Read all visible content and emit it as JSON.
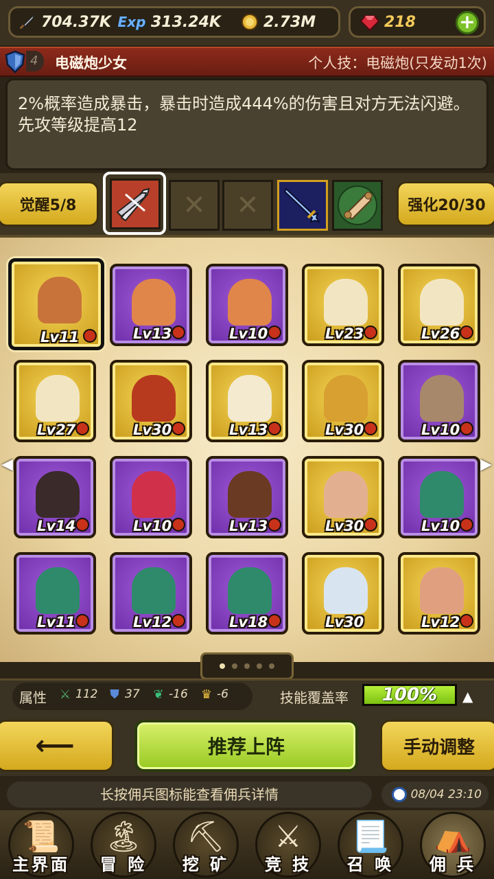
{
  "top": {
    "attack": "704.37K",
    "exp_label": "Exp",
    "exp": "313.24K",
    "gold": "2.73M",
    "gems": "218"
  },
  "skill": {
    "rank": "4",
    "name": "电磁炮少女",
    "personal": "个人技：电磁炮(只发动1次)",
    "description": "2%概率造成暴击，暴击时造成444%的伤害且对方无法闪避。先攻等级提高12"
  },
  "awaken": {
    "label": "觉醒5/8"
  },
  "enhance": {
    "label": "强化20/30"
  },
  "equipment": [
    {
      "icon": "crossed-swords-icon",
      "state": "selected"
    },
    {
      "icon": "empty-slot-icon",
      "state": "empty"
    },
    {
      "icon": "empty-slot-icon",
      "state": "empty"
    },
    {
      "icon": "blue-sword-icon",
      "state": "filled"
    },
    {
      "icon": "scroll-icon",
      "state": "filled"
    }
  ],
  "units": [
    {
      "level": "Lv11",
      "rarity": "gold",
      "color": "#c8733a",
      "selected": true
    },
    {
      "level": "Lv13",
      "rarity": "purple",
      "color": "#e0864a"
    },
    {
      "level": "Lv10",
      "rarity": "purple",
      "color": "#e0864a"
    },
    {
      "level": "Lv23",
      "rarity": "gold",
      "color": "#f2e6c2"
    },
    {
      "level": "Lv26",
      "rarity": "gold",
      "color": "#f2e6c2"
    },
    {
      "level": "Lv27",
      "rarity": "gold",
      "color": "#f2e6c2"
    },
    {
      "level": "Lv30",
      "rarity": "gold",
      "color": "#b83a1e"
    },
    {
      "level": "Lv13",
      "rarity": "gold",
      "color": "#f3ead0"
    },
    {
      "level": "Lv30",
      "rarity": "gold",
      "color": "#d8a030"
    },
    {
      "level": "Lv10",
      "rarity": "purple",
      "color": "#a8886a"
    },
    {
      "level": "Lv14",
      "rarity": "purple",
      "color": "#3a2a2a"
    },
    {
      "level": "Lv10",
      "rarity": "purple",
      "color": "#d0304a"
    },
    {
      "level": "Lv13",
      "rarity": "purple",
      "color": "#6a3a22"
    },
    {
      "level": "Lv30",
      "rarity": "gold",
      "color": "#e2b090"
    },
    {
      "level": "Lv10",
      "rarity": "purple",
      "color": "#2e8a6a"
    },
    {
      "level": "Lv11",
      "rarity": "purple",
      "color": "#2e8a6a"
    },
    {
      "level": "Lv12",
      "rarity": "purple",
      "color": "#2e8a6a"
    },
    {
      "level": "Lv18",
      "rarity": "purple",
      "color": "#2e8a6a"
    },
    {
      "level": "Lv30",
      "rarity": "gold",
      "color": "#d8e4f0",
      "nodot": true
    },
    {
      "level": "Lv12",
      "rarity": "gold",
      "color": "#e0a080"
    }
  ],
  "attributes": {
    "label": "属性",
    "values": [
      "112",
      "37",
      "-16",
      "-6"
    ],
    "coverage_label": "技能覆盖率",
    "coverage": "100%",
    "coverage_fraction": 1.0
  },
  "actions": {
    "back": "⟵",
    "recommend": "推荐上阵",
    "manual": "手动调整"
  },
  "hint": "长按佣兵图标能查看佣兵详情",
  "datetime": "08/04 23:10",
  "nav": [
    "主界面",
    "冒 险",
    "挖 矿",
    "竞 技",
    "召 唤",
    "佣 兵"
  ]
}
